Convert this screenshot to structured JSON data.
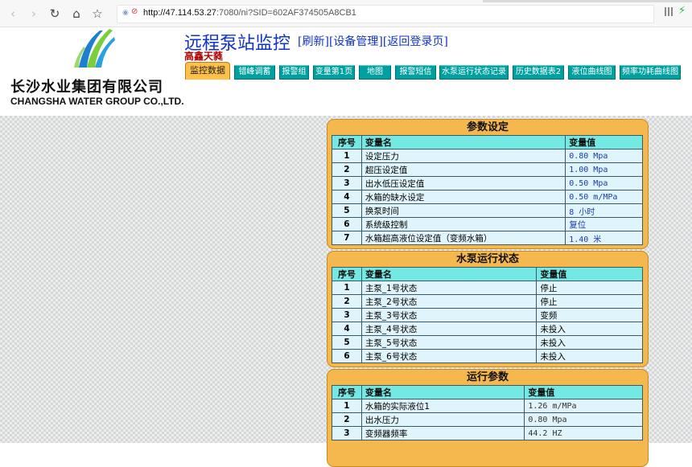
{
  "browser": {
    "url_host": "http://47.114.53.27",
    "url_rest": ":7080/ni?SID=602AF374505A8CB1"
  },
  "company": {
    "name_cn": "长沙水业集团有限公司",
    "name_en": "CHANGSHA WATER GROUP CO.,LTD."
  },
  "header": {
    "title": "远程泵站监控",
    "links": [
      "[刷新]",
      "[设备管理]",
      "[返回登录页]"
    ],
    "station": "高鑫天蕤"
  },
  "tabs": [
    {
      "label": "监控数据",
      "active": true
    },
    {
      "label": "错峰调蓄"
    },
    {
      "label": "报警组"
    },
    {
      "label": "变量第1页"
    },
    {
      "label": "地图"
    },
    {
      "label": "报警短信"
    },
    {
      "label": "水泵运行状态记录"
    },
    {
      "label": "历史数据表2"
    },
    {
      "label": "液位曲线图"
    },
    {
      "label": "频率功耗曲线图"
    }
  ],
  "panels": {
    "params": {
      "title": "参数设定",
      "headers": [
        "序号",
        "变量名",
        "变量值"
      ],
      "rows": [
        [
          "1",
          "设定压力",
          "0.80 Mpa"
        ],
        [
          "2",
          "超压设定值",
          "1.00 Mpa"
        ],
        [
          "3",
          "出水低压设定值",
          "0.50 Mpa"
        ],
        [
          "4",
          "水箱的缺水设定",
          "0.50 m/MPa"
        ],
        [
          "5",
          "换泵时间",
          "8 小时"
        ],
        [
          "6",
          "系统级控制",
          "复位"
        ],
        [
          "7",
          "水箱超高液位设定值（变频水箱）",
          "1.40 米"
        ]
      ]
    },
    "pump_status": {
      "title": "水泵运行状态",
      "headers": [
        "序号",
        "变量名",
        "变量值"
      ],
      "rows": [
        [
          "1",
          "主泵_1号状态",
          "停止"
        ],
        [
          "2",
          "主泵_2号状态",
          "停止"
        ],
        [
          "3",
          "主泵_3号状态",
          "变频"
        ],
        [
          "4",
          "主泵_4号状态",
          "未投入"
        ],
        [
          "5",
          "主泵_5号状态",
          "未投入"
        ],
        [
          "6",
          "主泵_6号状态",
          "未投入"
        ]
      ]
    },
    "run_params": {
      "title": "运行参数",
      "headers": [
        "序号",
        "变量名",
        "变量值"
      ],
      "rows": [
        [
          "1",
          "水箱的实际液位1",
          "1.26 m/MPa"
        ],
        [
          "2",
          "出水压力",
          "0.80 Mpa"
        ],
        [
          "3",
          "变频器频率",
          "44.2 HZ"
        ]
      ]
    }
  }
}
